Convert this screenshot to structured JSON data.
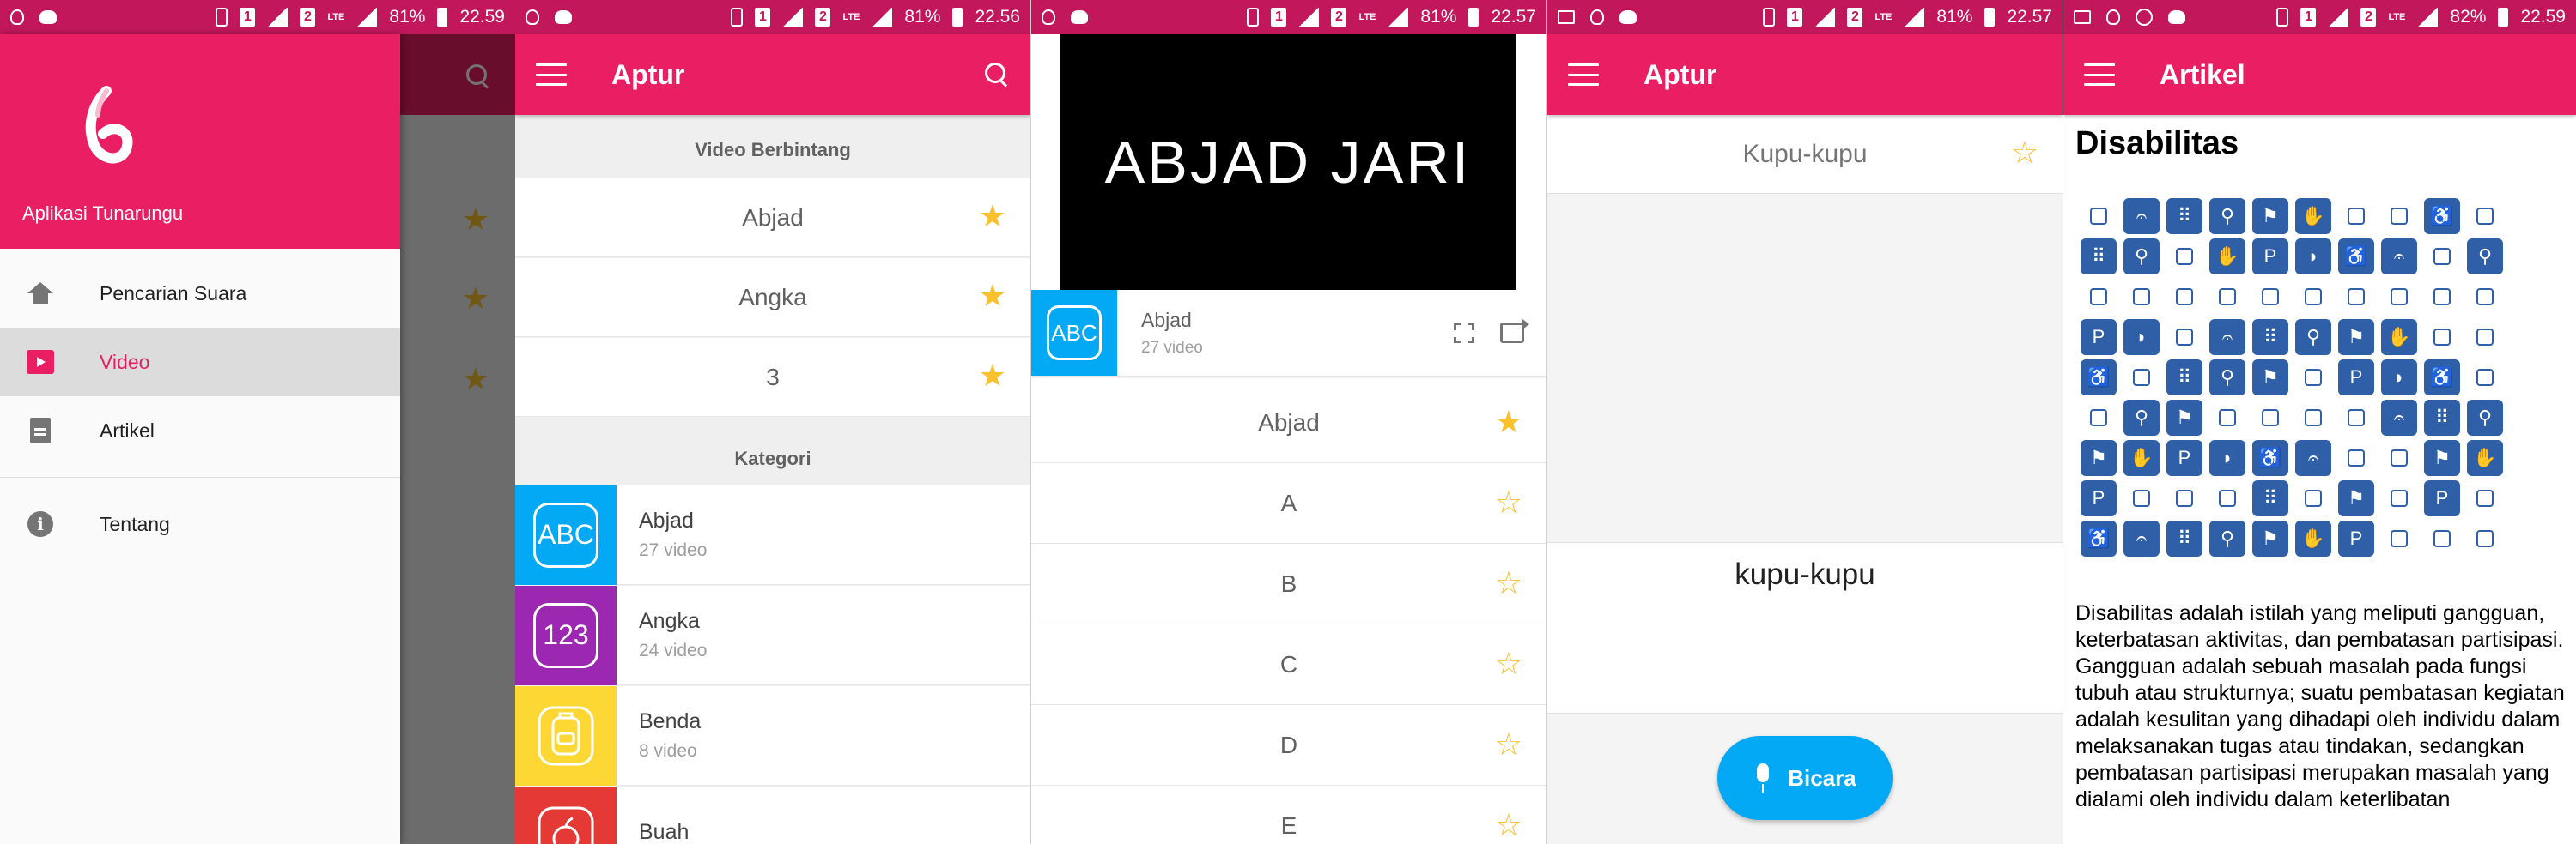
{
  "status_bars": [
    {
      "sim1": "1",
      "sim2": "2",
      "network": "LTE",
      "battery": "81%",
      "time": "22.59"
    },
    {
      "sim1": "1",
      "sim2": "2",
      "network": "LTE",
      "battery": "81%",
      "time": "22.56"
    },
    {
      "sim1": "1",
      "sim2": "2",
      "network": "LTE",
      "battery": "81%",
      "time": "22.57"
    },
    {
      "sim1": "1",
      "sim2": "2",
      "network": "LTE",
      "battery": "81%",
      "time": "22.57"
    },
    {
      "sim1": "1",
      "sim2": "2",
      "network": "LTE",
      "battery": "82%",
      "time": "22.59"
    }
  ],
  "colors": {
    "primary": "#e91e63",
    "status": "#c2185b",
    "star": "#fbc02d",
    "speak": "#03a9f4"
  },
  "drawer": {
    "app_name": "Aplikasi Tunarungu",
    "items": [
      {
        "label": "Pencarian Suara",
        "icon": "home-icon"
      },
      {
        "label": "Video",
        "icon": "video-icon"
      },
      {
        "label": "Artikel",
        "icon": "article-icon"
      },
      {
        "label": "Tentang",
        "icon": "info-icon"
      }
    ]
  },
  "home": {
    "title": "Aptur",
    "favorites_header": "Video Berbintang",
    "favorites": [
      "Abjad",
      "Angka",
      "3"
    ],
    "categories_header": "Kategori",
    "categories": [
      {
        "name": "Abjad",
        "count": "27 video",
        "glyph": "ABC",
        "color": "#03a9f4"
      },
      {
        "name": "Angka",
        "count": "24 video",
        "glyph": "123",
        "color": "#9c27b0"
      },
      {
        "name": "Benda",
        "count": "8 video",
        "glyph": "backpack-icon",
        "color": "#fdd835"
      },
      {
        "name": "Buah",
        "count": "",
        "glyph": "apple-icon",
        "color": "#e53935"
      }
    ]
  },
  "player": {
    "video_title": "ABJAD JARI",
    "category": "Abjad",
    "count": "27 video",
    "glyph": "ABC",
    "list": [
      {
        "label": "Abjad",
        "starred": true
      },
      {
        "label": "A",
        "starred": false
      },
      {
        "label": "B",
        "starred": false
      },
      {
        "label": "C",
        "starred": false
      },
      {
        "label": "D",
        "starred": false
      },
      {
        "label": "E",
        "starred": false
      }
    ]
  },
  "voice": {
    "title": "Aptur",
    "result": "Kupu-kupu",
    "recognized": "kupu-kupu",
    "button": "Bicara"
  },
  "article": {
    "toolbar_title": "Artikel",
    "heading": "Disabilitas",
    "grid_symbols": [
      "wheelchair",
      "deaf",
      "braille",
      "blind",
      "guide-dog",
      "sign-language",
      "parking",
      "hearing-aid"
    ],
    "body": "Disabilitas adalah istilah yang meliputi gangguan, keterbatasan aktivitas, dan pembatasan partisipasi. Gangguan adalah sebuah masalah pada fungsi tubuh atau strukturnya; suatu pembatasan kegiatan adalah kesulitan yang dihadapi oleh individu dalam melaksanakan tugas atau tindakan, sedangkan pembatasan partisipasi merupakan masalah yang dialami oleh individu dalam keterlibatan"
  }
}
